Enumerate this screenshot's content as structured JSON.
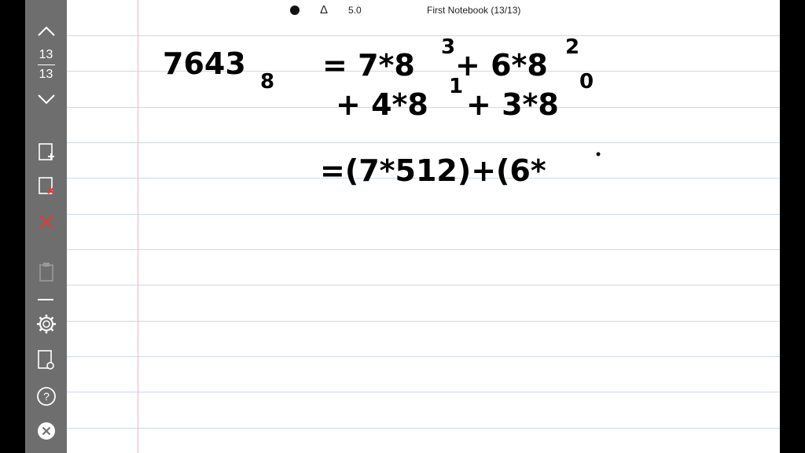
{
  "header": {
    "pen_symbol": "Δ",
    "pen_size": "5.0",
    "notebook_title": "First Notebook (13/13)"
  },
  "sidebar": {
    "page_current": "13",
    "page_total": "13",
    "icons": [
      "chevron-up-icon",
      "chevron-down-icon",
      "add-page-icon",
      "delete-page-icon",
      "close-x-icon",
      "clipboard-icon",
      "settings-gear-icon",
      "page-settings-icon",
      "help-icon",
      "exit-icon"
    ]
  },
  "colors": {
    "toolbar": "#6e6e6e",
    "red_icon": "#e53935",
    "rule_line": "#cfd9e6",
    "margin_line": "#f3b0c8"
  },
  "handwriting": {
    "line1_left": "7643",
    "line1_subscript": "8",
    "line1_right": "= 7*8",
    "line1_exp1": "3",
    "line1_cont": "+ 6*8",
    "line1_exp2": "2",
    "line2": "+ 4*8",
    "line2_exp1": "1",
    "line2_cont": "+ 3*8",
    "line2_exp2": "0",
    "line3": "=(7*512)+(6*"
  }
}
